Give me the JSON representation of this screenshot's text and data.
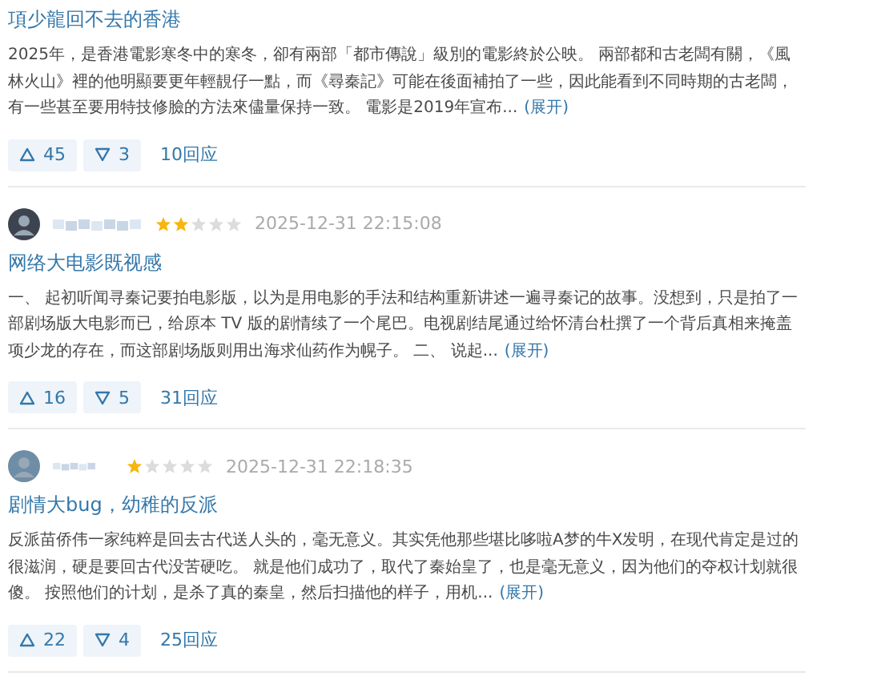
{
  "reviews": [
    {
      "title": "項少龍回不去的香港",
      "body": "2025年，是香港電影寒冬中的寒冬，卻有兩部「都市傳說」級別的電影終於公映。 兩部都和古老闆有關，《風林火山》裡的他明顯要更年輕靚仔一點，而《尋秦記》可能在後面補拍了一些，因此能看到不同時期的古老闆，有一些甚至要用特技修臉的方法來儘量保持一致。 電影是2019年宣布...",
      "expand": "(展开)",
      "useful": "45",
      "useless": "3",
      "replies": "10回应"
    },
    {
      "author": {
        "stars": 2
      },
      "date": "2025-12-31 22:15:08",
      "title": "网络大电影既视感",
      "body": "一、 起初听闻寻秦记要拍电影版，以为是用电影的手法和结构重新讲述一遍寻秦记的故事。没想到，只是拍了一部剧场版大电影而已，给原本 TV 版的剧情续了一个尾巴。电视剧结尾通过给怀清台杜撰了一个背后真相来掩盖项少龙的存在，而这部剧场版则用出海求仙药作为幌子。 二、 说起...",
      "expand": "(展开)",
      "useful": "16",
      "useless": "5",
      "replies": "31回应"
    },
    {
      "author": {
        "stars": 1
      },
      "date": "2025-12-31 22:18:35",
      "title": "剧情大bug，幼稚的反派",
      "body": "反派苗侨伟一家纯粹是回去古代送人头的，毫无意义。其实凭他那些堪比哆啦A梦的牛X发明，在现代肯定是过的很滋润，硬是要回古代没苦硬吃。 就是他们成功了，取代了秦始皇了，也是毫无意义，因为他们的夺权计划就很傻。 按照他们的计划，是杀了真的秦皇，然后扫描他的样子，用机...",
      "expand": "(展开)",
      "useful": "22",
      "useless": "4",
      "replies": "25回应"
    }
  ]
}
